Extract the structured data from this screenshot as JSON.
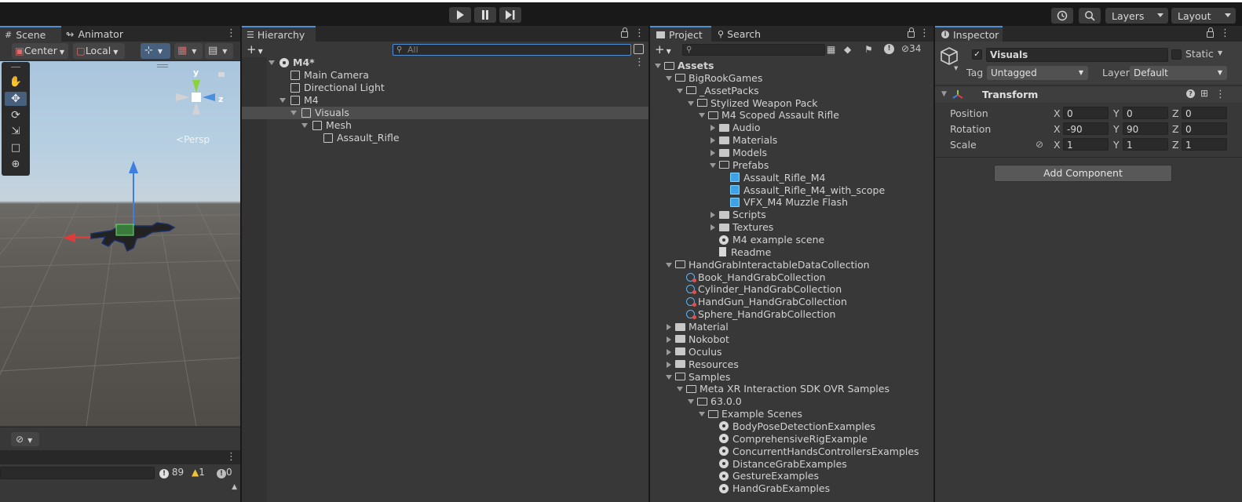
{
  "toolbar": {
    "play_icon": "play-icon",
    "pause_icon": "pause-icon",
    "step_icon": "step-icon",
    "history_icon": "history-icon",
    "search_icon": "search-icon",
    "layers_label": "Layers",
    "layout_label": "Layout"
  },
  "scene": {
    "tabs": [
      "Scene",
      "Animator"
    ],
    "pivot_label": "Center",
    "space_label": "Local",
    "persp_label": "Persp",
    "gizmo_axes": {
      "y": "y",
      "z": "z"
    }
  },
  "console": {
    "error_count": "89",
    "warning_count": "1",
    "info_count": "0"
  },
  "hierarchy": {
    "tab": "Hierarchy",
    "search_placeholder": "All",
    "items": [
      {
        "label": "M4*",
        "depth": 0,
        "icon": "scene-icon",
        "expanded": true
      },
      {
        "label": "Main Camera",
        "depth": 1,
        "icon": "cube-icon"
      },
      {
        "label": "Directional Light",
        "depth": 1,
        "icon": "cube-icon"
      },
      {
        "label": "M4",
        "depth": 1,
        "icon": "cube-icon",
        "expanded": true
      },
      {
        "label": "Visuals",
        "depth": 2,
        "icon": "cube-icon",
        "expanded": true,
        "selected": true
      },
      {
        "label": "Mesh",
        "depth": 3,
        "icon": "cube-icon",
        "expanded": true
      },
      {
        "label": "Assault_Rifle",
        "depth": 4,
        "icon": "cube-icon"
      }
    ]
  },
  "project": {
    "tabs": [
      "Project",
      "Search"
    ],
    "hidden_count": "34",
    "items": [
      {
        "label": "Assets",
        "depth": 0,
        "type": "folder-open",
        "expanded": true,
        "bold": true
      },
      {
        "label": "BigRookGames",
        "depth": 1,
        "type": "folder-open",
        "expanded": true
      },
      {
        "label": "_AssetPacks",
        "depth": 2,
        "type": "folder-open",
        "expanded": true
      },
      {
        "label": "Stylized Weapon Pack",
        "depth": 3,
        "type": "folder-open",
        "expanded": true
      },
      {
        "label": "M4 Scoped Assault Rifle",
        "depth": 4,
        "type": "folder-open",
        "expanded": true
      },
      {
        "label": "Audio",
        "depth": 5,
        "type": "folder",
        "expanded": false
      },
      {
        "label": "Materials",
        "depth": 5,
        "type": "folder",
        "expanded": false
      },
      {
        "label": "Models",
        "depth": 5,
        "type": "folder",
        "expanded": false
      },
      {
        "label": "Prefabs",
        "depth": 5,
        "type": "folder-open",
        "expanded": true
      },
      {
        "label": "Assault_Rifle_M4",
        "depth": 6,
        "type": "prefab"
      },
      {
        "label": "Assault_Rifle_M4_with_scope",
        "depth": 6,
        "type": "prefab"
      },
      {
        "label": "VFX_M4 Muzzle Flash",
        "depth": 6,
        "type": "prefab"
      },
      {
        "label": "Scripts",
        "depth": 5,
        "type": "folder",
        "expanded": false
      },
      {
        "label": "Textures",
        "depth": 5,
        "type": "folder",
        "expanded": false
      },
      {
        "label": "M4 example scene",
        "depth": 5,
        "type": "scene"
      },
      {
        "label": "Readme",
        "depth": 5,
        "type": "doc"
      },
      {
        "label": "HandGrabInteractableDataCollection",
        "depth": 1,
        "type": "folder-open",
        "expanded": true
      },
      {
        "label": "Book_HandGrabCollection",
        "depth": 2,
        "type": "asset"
      },
      {
        "label": "Cylinder_HandGrabCollection",
        "depth": 2,
        "type": "asset"
      },
      {
        "label": "HandGun_HandGrabCollection",
        "depth": 2,
        "type": "asset"
      },
      {
        "label": "Sphere_HandGrabCollection",
        "depth": 2,
        "type": "asset"
      },
      {
        "label": "Material",
        "depth": 1,
        "type": "folder",
        "expanded": false
      },
      {
        "label": "Nokobot",
        "depth": 1,
        "type": "folder",
        "expanded": false
      },
      {
        "label": "Oculus",
        "depth": 1,
        "type": "folder",
        "expanded": false
      },
      {
        "label": "Resources",
        "depth": 1,
        "type": "folder",
        "expanded": false
      },
      {
        "label": "Samples",
        "depth": 1,
        "type": "folder-open",
        "expanded": true
      },
      {
        "label": "Meta XR Interaction SDK OVR Samples",
        "depth": 2,
        "type": "folder-open",
        "expanded": true
      },
      {
        "label": "63.0.0",
        "depth": 3,
        "type": "folder-open",
        "expanded": true
      },
      {
        "label": "Example Scenes",
        "depth": 4,
        "type": "folder-open",
        "expanded": true
      },
      {
        "label": "BodyPoseDetectionExamples",
        "depth": 5,
        "type": "scene"
      },
      {
        "label": "ComprehensiveRigExample",
        "depth": 5,
        "type": "scene"
      },
      {
        "label": "ConcurrentHandsControllersExamples",
        "depth": 5,
        "type": "scene"
      },
      {
        "label": "DistanceGrabExamples",
        "depth": 5,
        "type": "scene"
      },
      {
        "label": "GestureExamples",
        "depth": 5,
        "type": "scene"
      },
      {
        "label": "HandGrabExamples",
        "depth": 5,
        "type": "scene"
      }
    ]
  },
  "inspector": {
    "tab": "Inspector",
    "object_name": "Visuals",
    "active": true,
    "static_label": "Static",
    "tag_label": "Tag",
    "tag_value": "Untagged",
    "layer_label": "Layer",
    "layer_value": "Default",
    "transform_title": "Transform",
    "position_label": "Position",
    "rotation_label": "Rotation",
    "scale_label": "Scale",
    "axis_x": "X",
    "axis_y": "Y",
    "axis_z": "Z",
    "position": {
      "x": "0",
      "y": "0",
      "z": "0"
    },
    "rotation": {
      "x": "-90",
      "y": "90",
      "z": "0"
    },
    "scale": {
      "x": "1",
      "y": "1",
      "z": "1"
    },
    "add_component_label": "Add Component"
  },
  "colors": {
    "accent": "#4e8fd6",
    "selection": "#4d4d4d",
    "panel": "#383838",
    "toolbar": "#191919"
  }
}
